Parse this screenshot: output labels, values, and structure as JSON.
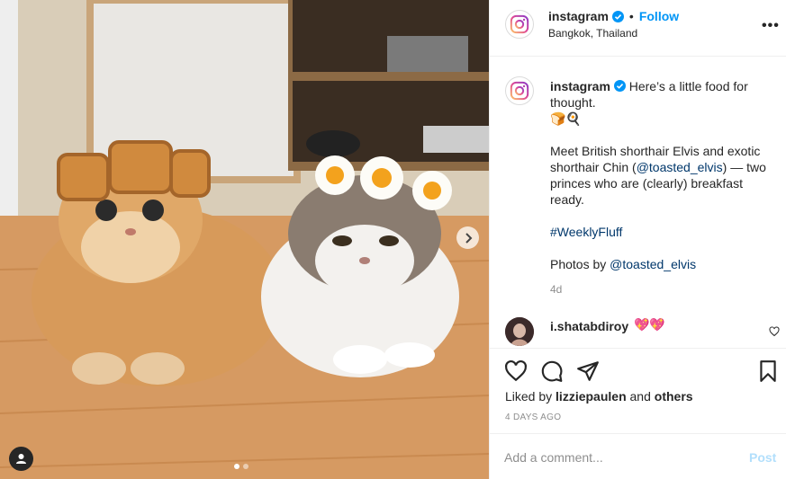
{
  "post": {
    "username": "instagram",
    "location": "Bangkok, Thailand",
    "follow_label": "Follow",
    "separator": "•",
    "more_label": "•••"
  },
  "caption": {
    "username": "instagram",
    "line1": "Here’s a little food for thought.",
    "emoji": "🍞🍳",
    "para1_a": "Meet British shorthair Elvis and exotic shorthair Chin (",
    "para1_mention": "@toasted_elvis",
    "para1_b": ") — two princes who are (clearly) breakfast ready.",
    "hashtag": "#WeeklyFluff",
    "photos_by": "Photos by ",
    "photos_mention": "@toasted_elvis",
    "time": "4d"
  },
  "comment": {
    "username": "i.shatabdiroy",
    "text": "💖💖"
  },
  "likes": {
    "prefix": "Liked by ",
    "user": "lizziepaulen",
    "and": " and ",
    "others": "others"
  },
  "date": "4 DAYS AGO",
  "add_comment": {
    "placeholder": "Add a comment...",
    "post_label": "Post"
  },
  "carousel": {
    "slides": 2,
    "current": 1
  },
  "icons": {
    "header_avatar": "instagram-logo-icon",
    "caption_avatar": "instagram-logo-icon",
    "verified": "verified-badge-icon",
    "like": "heart-icon",
    "comment": "comment-bubble-icon",
    "share": "paper-plane-icon",
    "save": "bookmark-icon",
    "next": "chevron-right-icon",
    "tag": "user-tag-icon"
  },
  "colors": {
    "link": "#0095f6",
    "verified": "#0095f6",
    "post_disabled": "#b2dffc",
    "muted": "#8e8e8e"
  }
}
